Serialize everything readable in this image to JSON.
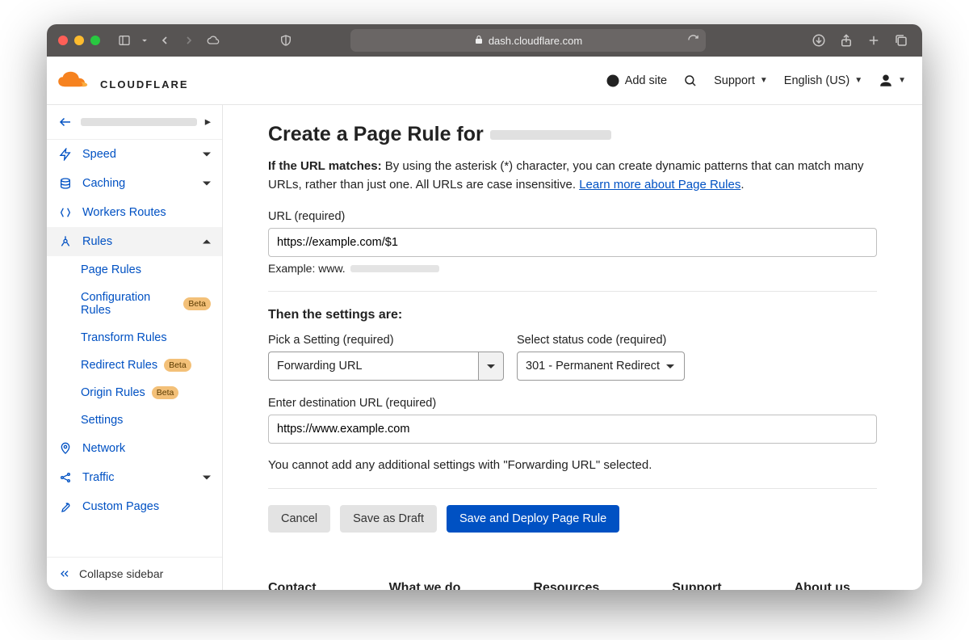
{
  "browser": {
    "address_host": "dash.cloudflare.com"
  },
  "header": {
    "logo_text": "CLOUDFLARE",
    "add_site": "Add site",
    "support": "Support",
    "language": "English (US)"
  },
  "sidebar": {
    "items": {
      "speed": "Speed",
      "caching": "Caching",
      "workers": "Workers Routes",
      "rules": "Rules",
      "network": "Network",
      "traffic": "Traffic",
      "custom_pages": "Custom Pages"
    },
    "rules_sub": {
      "page_rules": "Page Rules",
      "configuration_rules": "Configuration Rules",
      "transform_rules": "Transform Rules",
      "redirect_rules": "Redirect Rules",
      "origin_rules": "Origin Rules",
      "settings": "Settings"
    },
    "badge_beta": "Beta",
    "collapse": "Collapse sidebar"
  },
  "page": {
    "title_prefix": "Create a Page Rule for",
    "intro_bold": "If the URL matches:",
    "intro_text": " By using the asterisk (*) character, you can create dynamic patterns that can match many URLs, rather than just one. All URLs are case insensitive. ",
    "intro_link": "Learn more about Page Rules",
    "url_label": "URL (required)",
    "url_value": "https://example.com/$1",
    "url_hint_prefix": "Example: www.",
    "settings_head": "Then the settings are:",
    "pick_setting_label": "Pick a Setting (required)",
    "pick_setting_value": "Forwarding URL",
    "status_label": "Select status code (required)",
    "status_value": "301 - Permanent Redirect",
    "dest_label": "Enter destination URL (required)",
    "dest_value": "https://www.example.com",
    "note": "You cannot add any additional settings with \"Forwarding URL\" selected.",
    "btn_cancel": "Cancel",
    "btn_draft": "Save as Draft",
    "btn_deploy": "Save and Deploy Page Rule"
  },
  "footer": {
    "contact": "Contact",
    "whatwedo": "What we do",
    "resources": "Resources",
    "support": "Support",
    "about": "About us"
  }
}
